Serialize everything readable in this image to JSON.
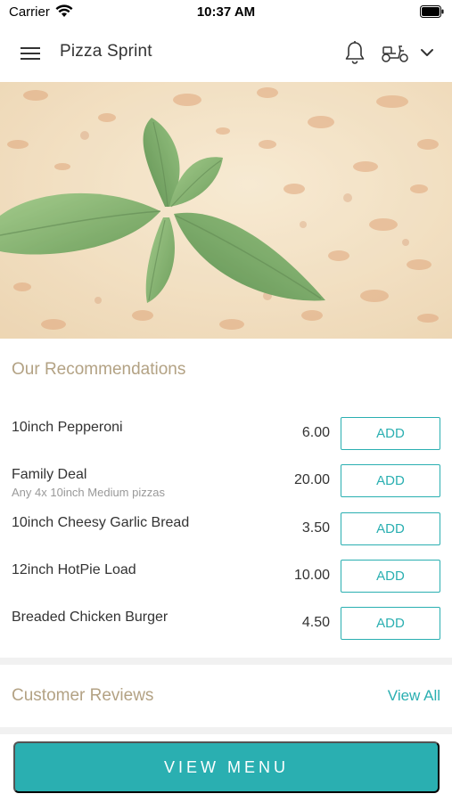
{
  "status_bar": {
    "carrier": "Carrier",
    "time": "10:37 AM"
  },
  "app_bar": {
    "title": "Pizza Sprint",
    "icons": [
      "hamburger-menu-icon",
      "bell-icon",
      "scooter-icon",
      "chevron-down-icon"
    ]
  },
  "recommendations": {
    "title": "Our Recommendations",
    "items": [
      {
        "name": "10inch Pepperoni",
        "description": "",
        "price": "6.00",
        "button": "ADD"
      },
      {
        "name": "Family Deal",
        "description": "Any 4x 10inch Medium pizzas",
        "price": "20.00",
        "button": "ADD"
      },
      {
        "name": "10inch Cheesy Garlic Bread",
        "description": "",
        "price": "3.50",
        "button": "ADD"
      },
      {
        "name": "12inch HotPie Load",
        "description": "",
        "price": "10.00",
        "button": "ADD"
      },
      {
        "name": "Breaded Chicken Burger",
        "description": "",
        "price": "4.50",
        "button": "ADD"
      }
    ]
  },
  "reviews": {
    "title": "Customer Reviews",
    "view_all": "View All"
  },
  "footer": {
    "view_menu": "VIEW MENU"
  },
  "colors": {
    "accent": "#2aafb1",
    "section_title": "#b3a284",
    "text": "#333333",
    "muted": "#999999"
  }
}
